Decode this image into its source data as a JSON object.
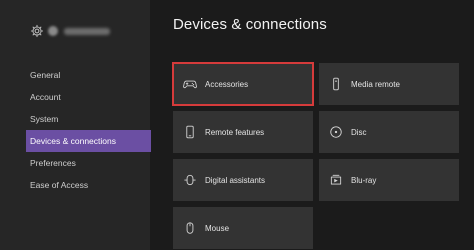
{
  "page": {
    "title": "Devices & connections"
  },
  "sidebar": {
    "items": [
      {
        "label": "General"
      },
      {
        "label": "Account"
      },
      {
        "label": "System"
      },
      {
        "label": "Devices & connections",
        "active": true
      },
      {
        "label": "Preferences"
      },
      {
        "label": "Ease of Access"
      }
    ]
  },
  "tiles": [
    {
      "label": "Accessories",
      "icon": "controller-icon",
      "highlighted": true
    },
    {
      "label": "Media remote",
      "icon": "remote-icon"
    },
    {
      "label": "Remote features",
      "icon": "phone-icon"
    },
    {
      "label": "Disc",
      "icon": "disc-icon"
    },
    {
      "label": "Digital assistants",
      "icon": "assistant-icon"
    },
    {
      "label": "Blu-ray",
      "icon": "bluray-icon"
    },
    {
      "label": "Mouse",
      "icon": "mouse-icon"
    }
  ],
  "colors": {
    "accent": "#6b4fa3",
    "highlight_border": "#d63b3b",
    "tile_bg": "#333333",
    "sidebar_bg": "#262626",
    "main_bg": "#1b1b1b"
  }
}
